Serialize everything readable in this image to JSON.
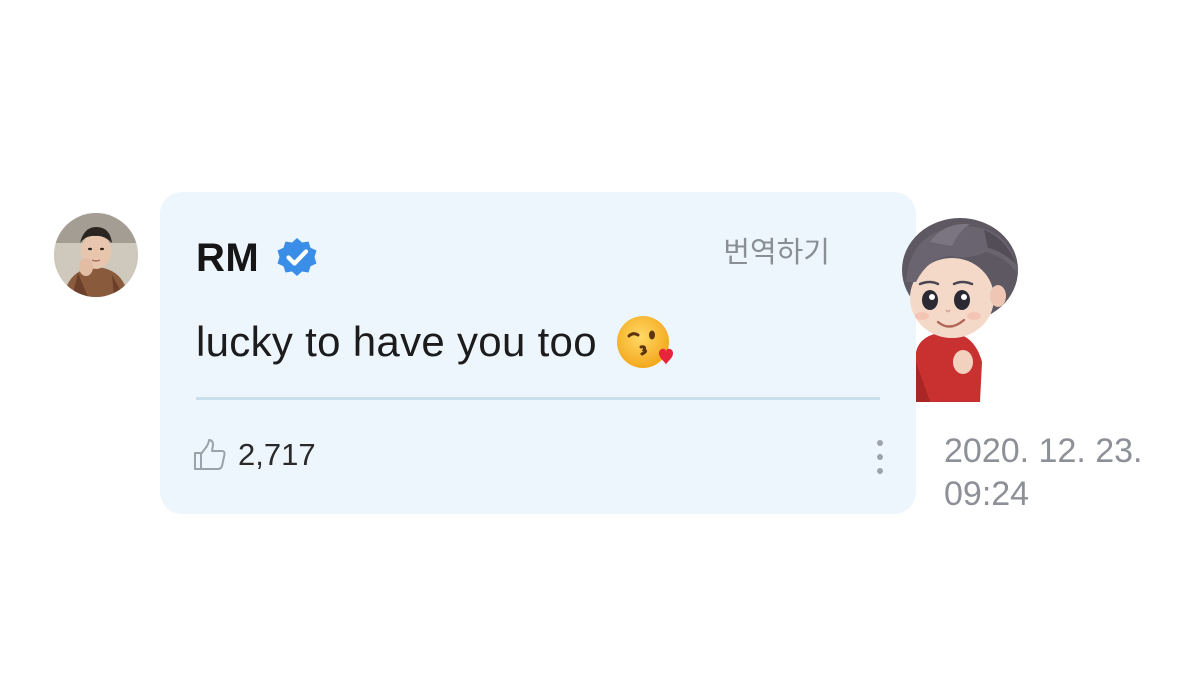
{
  "comment": {
    "author": "RM",
    "verified": true,
    "translate_label": "번역하기",
    "text": "lucky to have you too",
    "emoji": "kissing-face-with-heart-emoji",
    "like_count": "2,717",
    "date": "2020. 12. 23.",
    "time": "09:24"
  },
  "colors": {
    "bubble_background": "#eef6fd",
    "verified_badge": "#3b8ee8",
    "divider": "#c9e0ec",
    "muted_text": "#8d9197"
  },
  "icons": {
    "verified": "verified-badge-icon",
    "like": "thumbs-up-icon",
    "more": "more-vertical-icon"
  }
}
